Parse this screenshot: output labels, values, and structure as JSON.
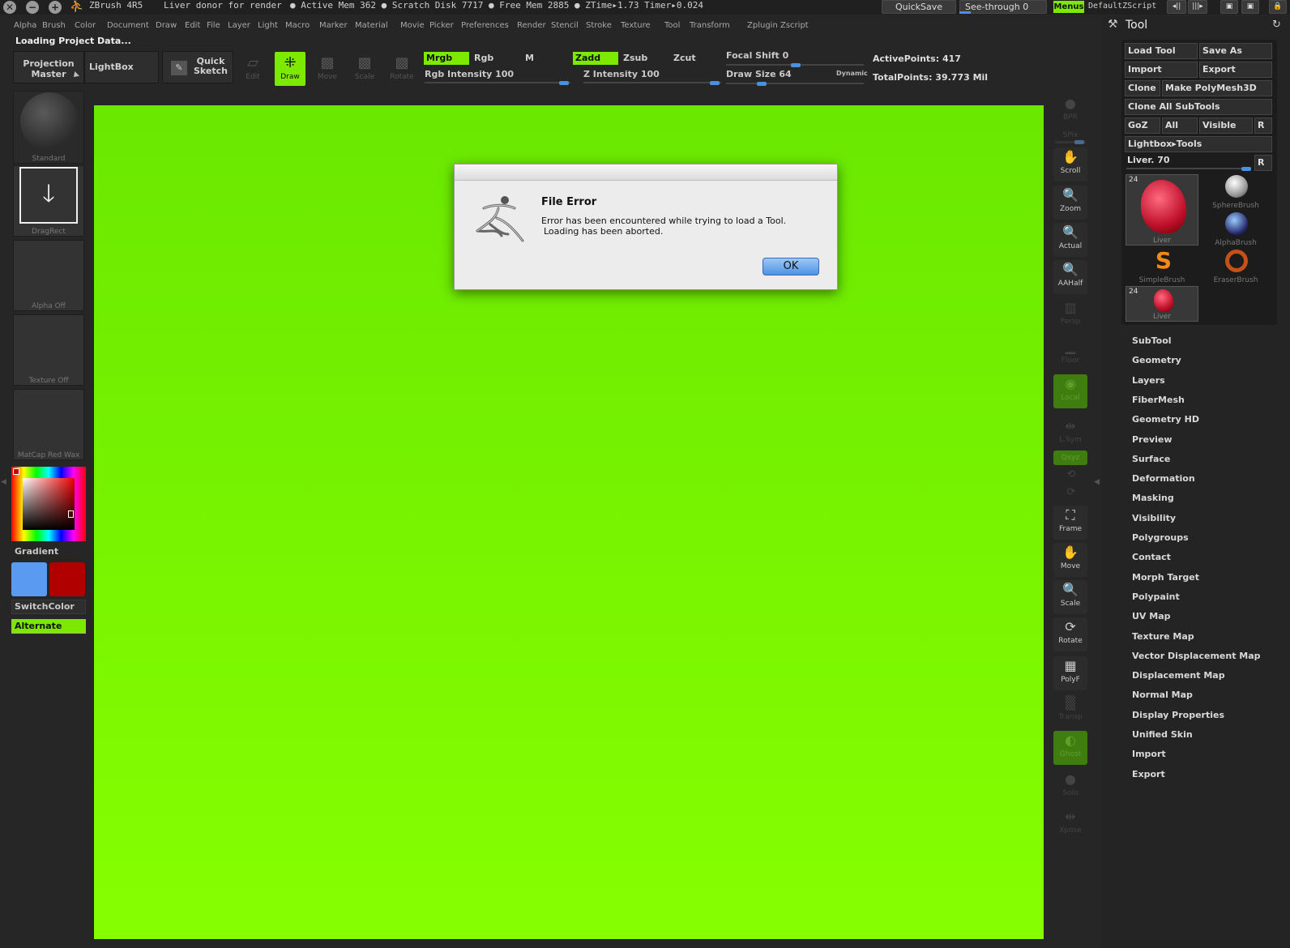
{
  "app": {
    "title": "ZBrush 4R5",
    "document": "Liver donor for render",
    "stats": "● Active Mem 362 ● Scratch Disk 7717 ● Free Mem 2885 ● ZTime▸1.73 Timer▸0.024",
    "quicksave": "QuickSave",
    "see_through": "See-through   0",
    "menus": "Menus",
    "script": "DefaultZScript"
  },
  "menu": [
    "Alpha",
    "Brush",
    "Color",
    "Document",
    "Draw",
    "Edit",
    "File",
    "Layer",
    "Light",
    "Macro",
    "Marker",
    "Material",
    "Movie",
    "Picker",
    "Preferences",
    "Render",
    "Stencil",
    "Stroke",
    "Texture",
    "Tool",
    "Transform",
    "Zplugin",
    "Zscript"
  ],
  "status": "Loading Project Data...",
  "toolbar": {
    "projection_master": "Projection Master",
    "lightbox": "LightBox",
    "quick_sketch": "Quick Sketch",
    "edit": "Edit",
    "draw": "Draw",
    "move": "Move",
    "scale": "Scale",
    "rotate": "Rotate",
    "mrgb": "Mrgb",
    "rgb": "Rgb",
    "m": "M",
    "zadd": "Zadd",
    "zsub": "Zsub",
    "zcut": "Zcut",
    "rgb_intensity": "Rgb Intensity 100",
    "z_intensity": "Z Intensity 100",
    "focal_shift": "Focal Shift 0",
    "draw_size": "Draw Size 64",
    "dynamic": "Dynamic",
    "active_points": "ActivePoints: 417",
    "total_points": "TotalPoints: 39.773 Mil"
  },
  "left": {
    "standard": "Standard",
    "dragrect": "DragRect",
    "alpha_off": "Alpha Off",
    "texture_off": "Texture Off",
    "matcap": "MatCap Red Wax",
    "gradient": "Gradient",
    "switch_color": "SwitchColor",
    "alternate": "Alternate",
    "primary_color": "#5a9af0",
    "secondary_color": "#b00000"
  },
  "shelf": [
    "BPR",
    "SPix",
    "Scroll",
    "Zoom",
    "Actual",
    "AAHalf",
    "Persp",
    "Floor",
    "Local",
    "L.Sym",
    "Qxyz",
    "Frame",
    "Move",
    "Scale",
    "Rotate",
    "PolyF",
    "Transp",
    "Ghost",
    "Solo",
    "Xpose"
  ],
  "tool_panel": {
    "title": "Tool",
    "load_tool": "Load Tool",
    "save_as": "Save As",
    "import": "Import",
    "export": "Export",
    "clone": "Clone",
    "make_polymesh": "Make PolyMesh3D",
    "clone_all": "Clone All SubTools",
    "goz": "GoZ",
    "all": "All",
    "visible": "Visible",
    "r": "R",
    "lightbox_tools": "Lightbox▸Tools",
    "liver_slider": "Liver. 70",
    "brushes": [
      {
        "name": "Liver",
        "count": "24"
      },
      {
        "name": "SphereBrush"
      },
      {
        "name": "AlphaBrush"
      },
      {
        "name": "SimpleBrush"
      },
      {
        "name": "EraserBrush"
      },
      {
        "name": "Liver",
        "count": "24"
      }
    ],
    "subpalettes": [
      "SubTool",
      "Geometry",
      "Layers",
      "FiberMesh",
      "Geometry HD",
      "Preview",
      "Surface",
      "Deformation",
      "Masking",
      "Visibility",
      "Polygroups",
      "Contact",
      "Morph Target",
      "Polypaint",
      "UV Map",
      "Texture Map",
      "Vector Displacement Map",
      "Displacement Map",
      "Normal Map",
      "Display Properties",
      "Unified Skin",
      "Import",
      "Export"
    ]
  },
  "dialog": {
    "title": "File Error",
    "line1": "Error has been encountered while trying to load a Tool.",
    "line2": "Loading has been aborted.",
    "ok": "OK"
  }
}
